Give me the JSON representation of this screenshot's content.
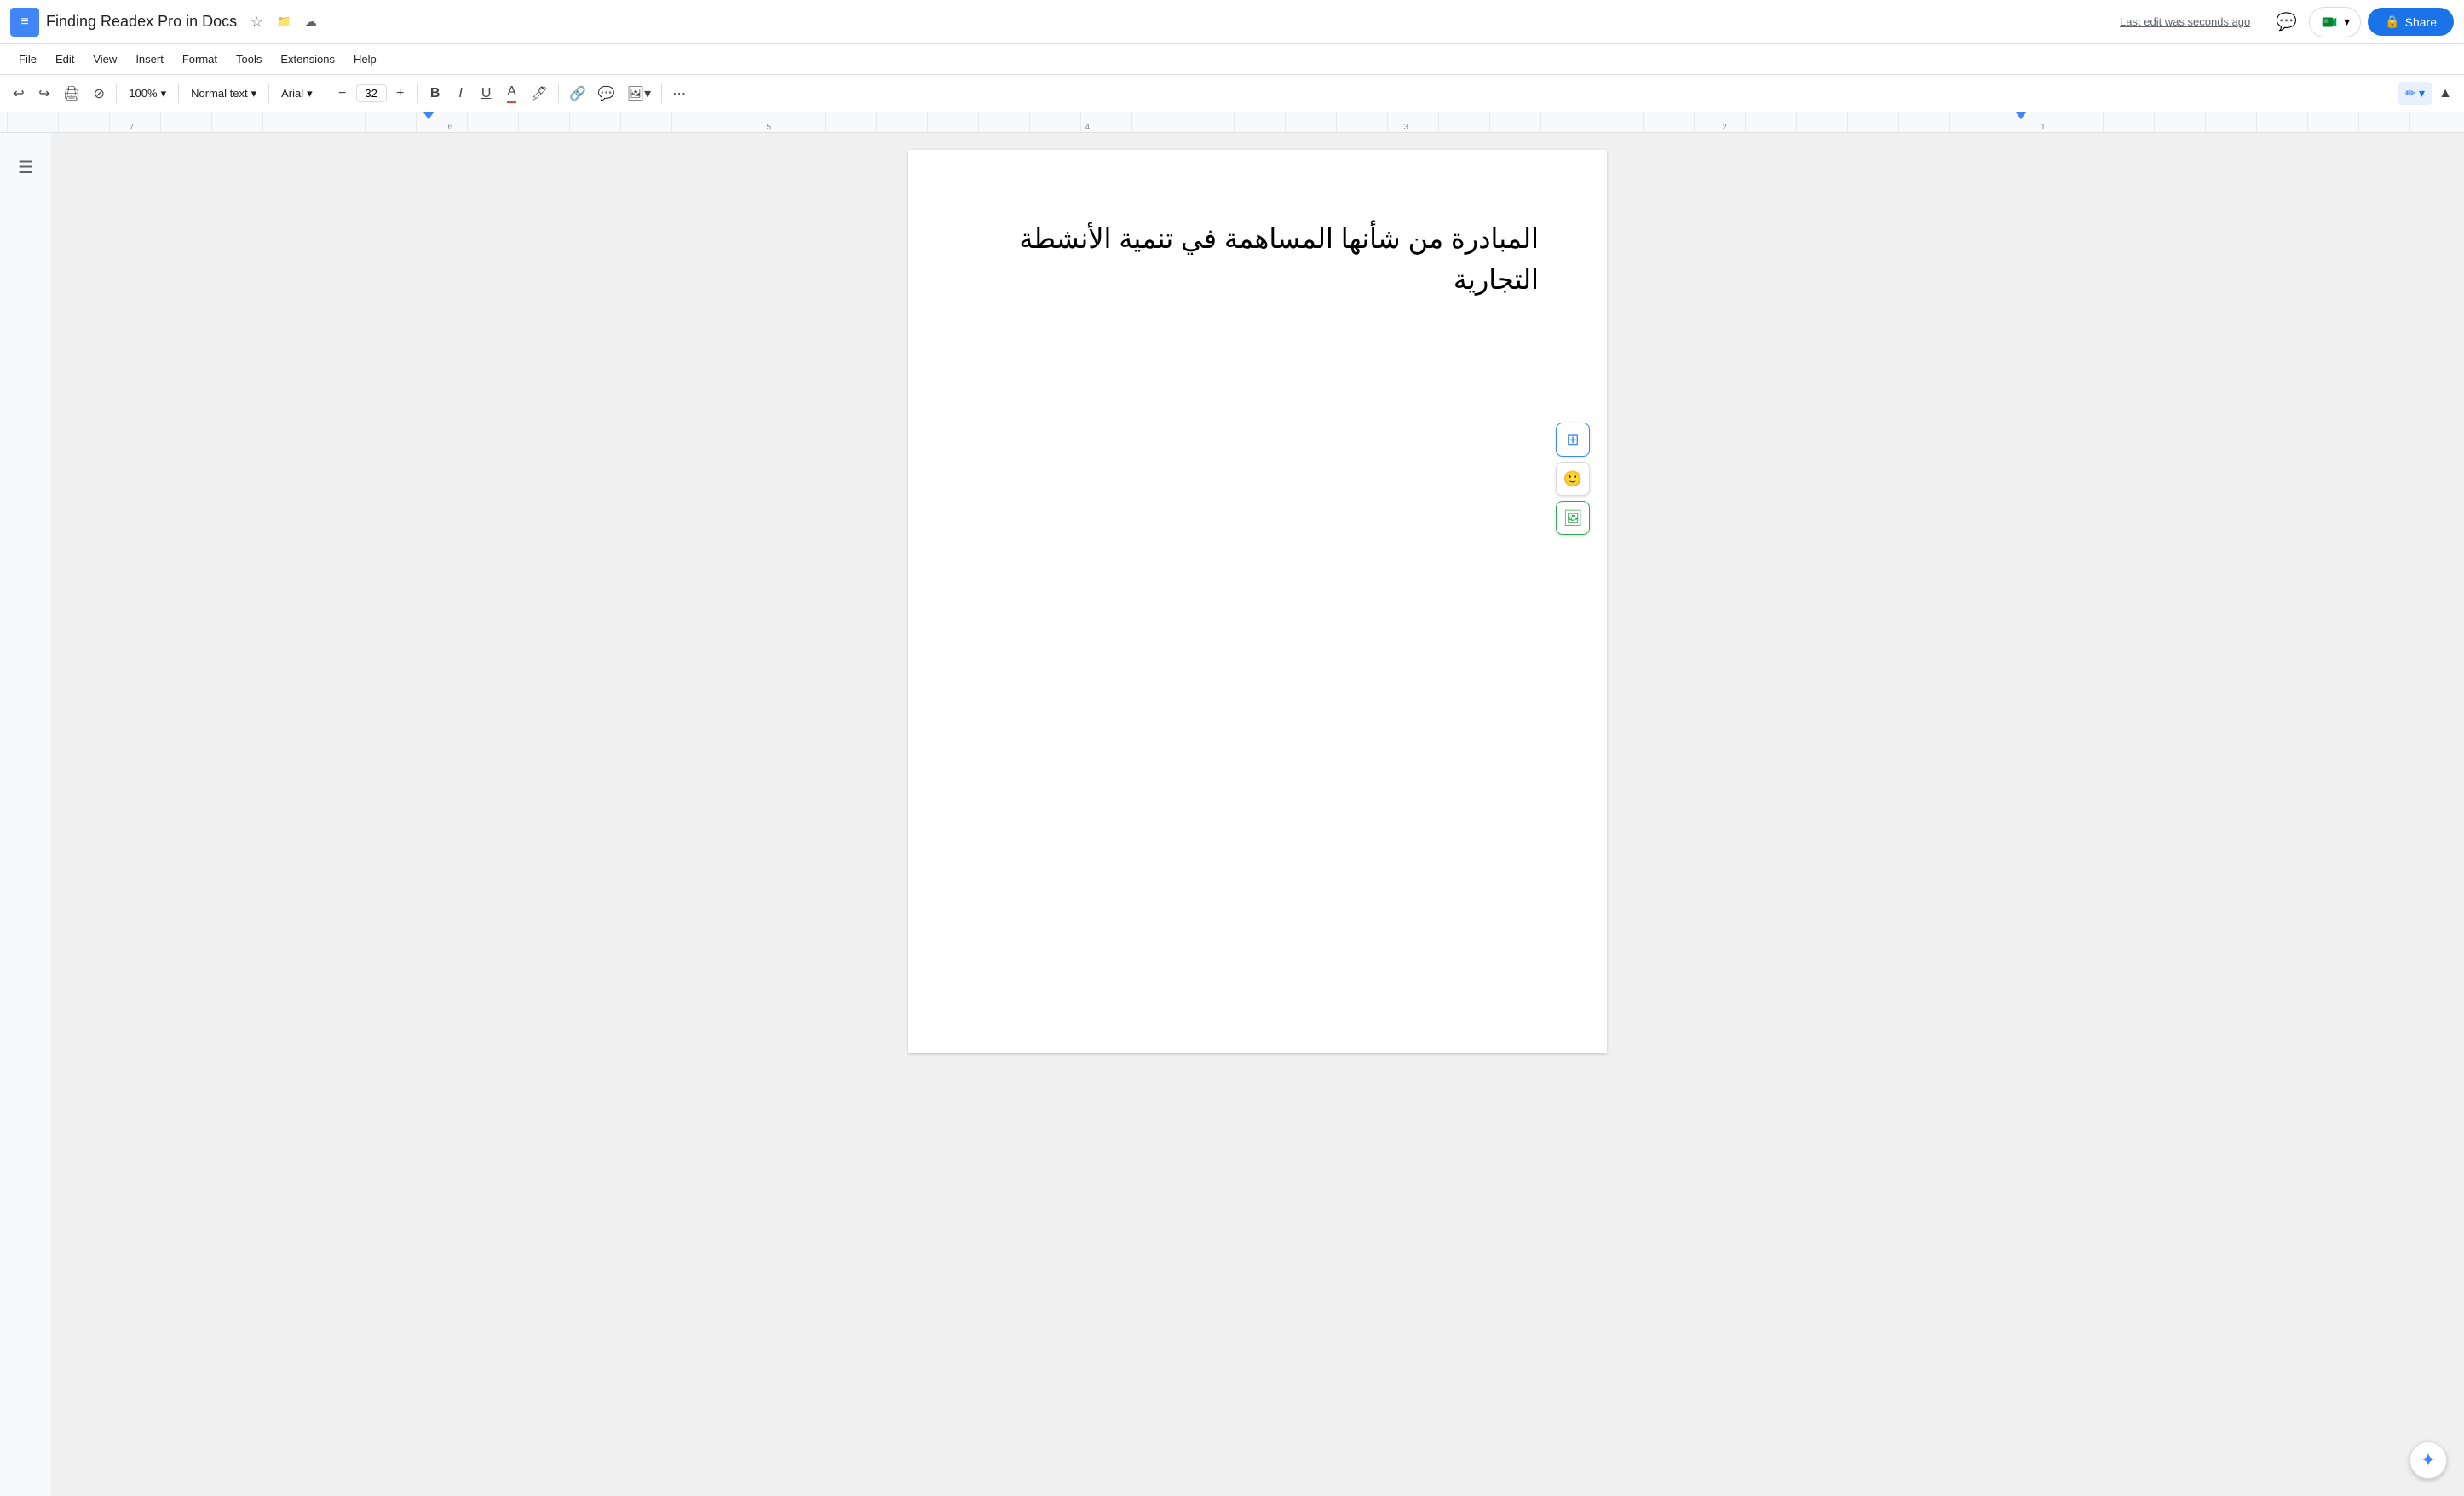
{
  "title_bar": {
    "app_icon": "≡",
    "doc_title": "Finding Readex Pro in Docs",
    "star_icon": "☆",
    "folder_icon": "⊡",
    "cloud_icon": "☁",
    "last_edit": "Last edit was seconds ago",
    "share_label": "Share",
    "lock_icon": "🔒"
  },
  "menu": {
    "items": [
      "File",
      "Edit",
      "View",
      "Insert",
      "Format",
      "Tools",
      "Extensions",
      "Help"
    ]
  },
  "toolbar": {
    "undo": "↩",
    "redo": "↪",
    "print": "🖨",
    "paint_format": "⊘",
    "zoom_label": "100%",
    "style_label": "Normal text",
    "font_label": "Arial",
    "font_size": "32",
    "bold": "B",
    "italic": "I",
    "underline": "U",
    "text_color": "A",
    "highlight": "✏",
    "link": "🔗",
    "comment": "💬",
    "image": "🖼",
    "more": "⋯",
    "edit_pencil": "✏"
  },
  "doc": {
    "arabic_text_line1": "المبادرة من شأنها المساهمة في تنمية الأنشطة",
    "arabic_text_line2": "التجارية"
  },
  "right_toolbar": {
    "add_comment": "+",
    "emoji": "🙂",
    "image_suggest": "🖼"
  },
  "style_dropdown": {
    "current": "Normal text"
  },
  "font_dropdown": {
    "current": "Arial"
  },
  "ai_btn": "✦"
}
